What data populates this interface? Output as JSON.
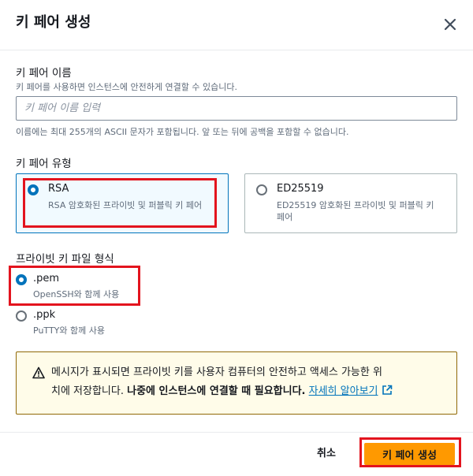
{
  "modal": {
    "title": "키 페어 생성"
  },
  "name_field": {
    "label": "키 페어 이름",
    "description": "키 페어를 사용하면 인스턴스에 안전하게 연결할 수 있습니다.",
    "placeholder": "키 페어 이름 입력",
    "value": "",
    "constraint": "이름에는 최대 255개의 ASCII 문자가 포함됩니다. 앞 또는 뒤에 공백을 포함할 수 없습니다."
  },
  "key_type": {
    "label": "키 페어 유형",
    "selected": "RSA",
    "options": [
      {
        "title": "RSA",
        "description": "RSA 암호화된 프라이빗 및 퍼블릭 키 페어"
      },
      {
        "title": "ED25519",
        "description": "ED25519 암호화된 프라이빗 및 퍼블릭 키 페어"
      }
    ]
  },
  "file_format": {
    "label": "프라이빗 키 파일 형식",
    "selected": ".pem",
    "options": [
      {
        "title": ".pem",
        "description": "OpenSSH와 함께 사용"
      },
      {
        "title": ".ppk",
        "description": "PuTTY와 함께 사용"
      }
    ]
  },
  "alert": {
    "icon": "warning-icon",
    "text_line1": "메시지가 표시되면 프라이빗 키를 사용자 컴퓨터의 안전하고 액세스 가능한 위",
    "text_line2": "치에 저장합니다. ",
    "bold_text": "나중에 인스턴스에 연결할 때 필요합니다.",
    "link_text": "자세히 알아보기"
  },
  "footer": {
    "cancel_label": "취소",
    "create_label": "키 페어 생성"
  },
  "colors": {
    "accent": "#0073bb",
    "primary_button": "#ff9900",
    "alert_bg": "#fffce9",
    "highlight": "#e3141e"
  }
}
